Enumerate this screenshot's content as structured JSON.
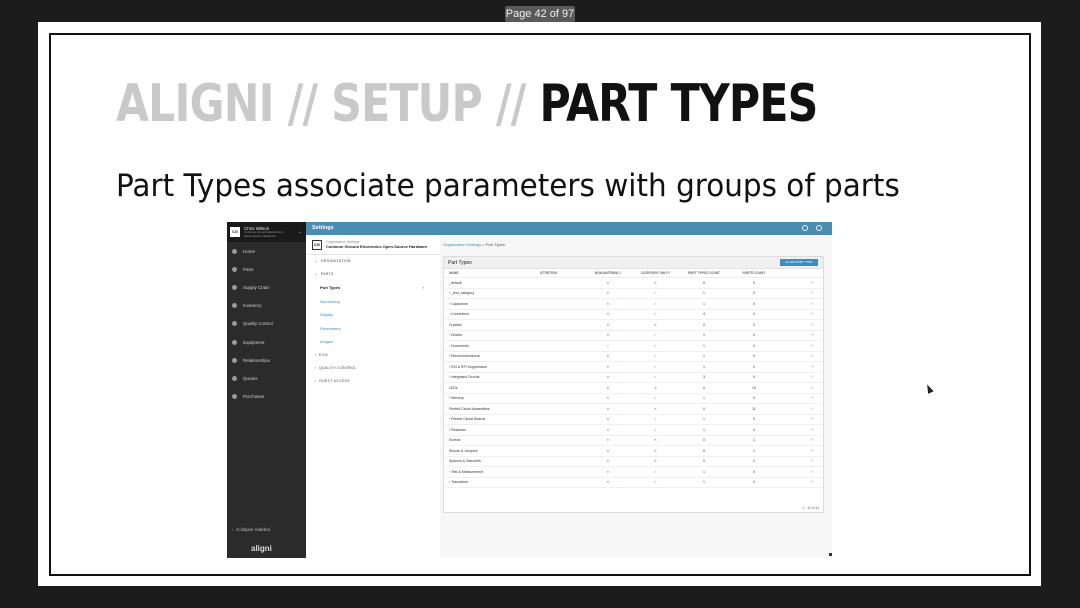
{
  "page_indicator": "Page 42 of 97",
  "slide": {
    "title_prefix": "ALIGNI // SETUP // ",
    "title_main": "PART TYPES",
    "subtitle": "Part Types associate parameters with groups of parts"
  },
  "app": {
    "user": {
      "initials": "CG",
      "name": "Chris Wilson",
      "org_line1": "Common Ground Electronics",
      "org_line2": "Open-Source Hardware"
    },
    "nav": [
      "Home",
      "Parts",
      "Supply Chain",
      "Inventory",
      "Quality Control",
      "Equipment",
      "Relationships",
      "Quotes",
      "Purchases"
    ],
    "collapse_label": "Collapse Sidebar",
    "logo": "aligni",
    "topbar_title": "Settings",
    "org": {
      "badge": "CG",
      "subtitle": "Organization Settings",
      "name": "Common Ground Electronics Open-Source Hardware"
    },
    "sections": {
      "organization": "ORGANIZATION",
      "parts": "PARTS",
      "ecm": "ECM",
      "quality_control": "QUALITY CONTROL",
      "guest_access": "GUEST ACCESS"
    },
    "parts_items": [
      "Part Types",
      "Numbering",
      "Display",
      "Parameters",
      "Images"
    ],
    "breadcrumb": {
      "parent": "Organization Settings",
      "sep": ">",
      "current": "Part Types"
    },
    "card_title": "Part Types",
    "add_button": "ADD PART TYPE",
    "columns": [
      "NAME",
      "ATTRITION",
      "NON-MATERIAL?",
      "CATEGORY ONLY?",
      "PART TYPES COUNT",
      "PARTS COUNT"
    ],
    "rows": [
      {
        "name": "_default",
        "nm": "x",
        "co": "x",
        "ptc": "0",
        "pc": "0"
      },
      {
        "name": "› _test_category",
        "nm": "x",
        "co": "✓",
        "ptc": "1",
        "pc": "0"
      },
      {
        "name": "› Capacitors",
        "nm": "x",
        "co": "✓",
        "ptc": "1",
        "pc": "0"
      },
      {
        "name": "› Connectors",
        "nm": "x",
        "co": "✓",
        "ptc": "4",
        "pc": "0"
      },
      {
        "name": "Crystals",
        "nm": "x",
        "co": "x",
        "ptc": "0",
        "pc": "2"
      },
      {
        "name": "› Diodes",
        "nm": "x",
        "co": "✓",
        "ptc": "1",
        "pc": "0"
      },
      {
        "name": "› Documents",
        "nm": "✓",
        "co": "✓",
        "ptc": "1",
        "pc": "0"
      },
      {
        "name": "› Electromechanical",
        "nm": "x",
        "co": "✓",
        "ptc": "1",
        "pc": "0"
      },
      {
        "name": "› ESI & RFI Suppression",
        "nm": "x",
        "co": "✓",
        "ptc": "1",
        "pc": "0"
      },
      {
        "name": "› Integrated Circuits",
        "nm": "x",
        "co": "✓",
        "ptc": "3",
        "pc": "0"
      },
      {
        "name": "LEDs",
        "nm": "x",
        "co": "x",
        "ptc": "0",
        "pc": "13"
      },
      {
        "name": "› Memory",
        "nm": "x",
        "co": "✓",
        "ptc": "1",
        "pc": "0"
      },
      {
        "name": "Printed Circuit Assemblies",
        "nm": "x",
        "co": "x",
        "ptc": "0",
        "pc": "11"
      },
      {
        "name": "› Printed Circuit Boards",
        "nm": "x",
        "co": "✓",
        "ptc": "1",
        "pc": "0"
      },
      {
        "name": "› Resistors",
        "nm": "x",
        "co": "✓",
        "ptc": "1",
        "pc": "0"
      },
      {
        "name": "Screws",
        "nm": "x",
        "co": "x",
        "ptc": "0",
        "pc": "1"
      },
      {
        "name": "Shunts & Jumpers",
        "nm": "x",
        "co": "x",
        "ptc": "0",
        "pc": "1"
      },
      {
        "name": "Spacers & Standoffs",
        "nm": "x",
        "co": "x",
        "ptc": "0",
        "pc": "1"
      },
      {
        "name": "› Test & Measurement",
        "nm": "x",
        "co": "✓",
        "ptc": "1",
        "pc": "0"
      },
      {
        "name": "› Transistors",
        "nm": "x",
        "co": "✓",
        "ptc": "1",
        "pc": "0"
      }
    ],
    "pager": "1 - 44 of 44"
  },
  "colors": {
    "topbar": "#4a8db0",
    "sidebar": "#2b2b2b",
    "link": "#3a8ec0",
    "cross": "#d9534f",
    "check": "#4cae4c"
  }
}
